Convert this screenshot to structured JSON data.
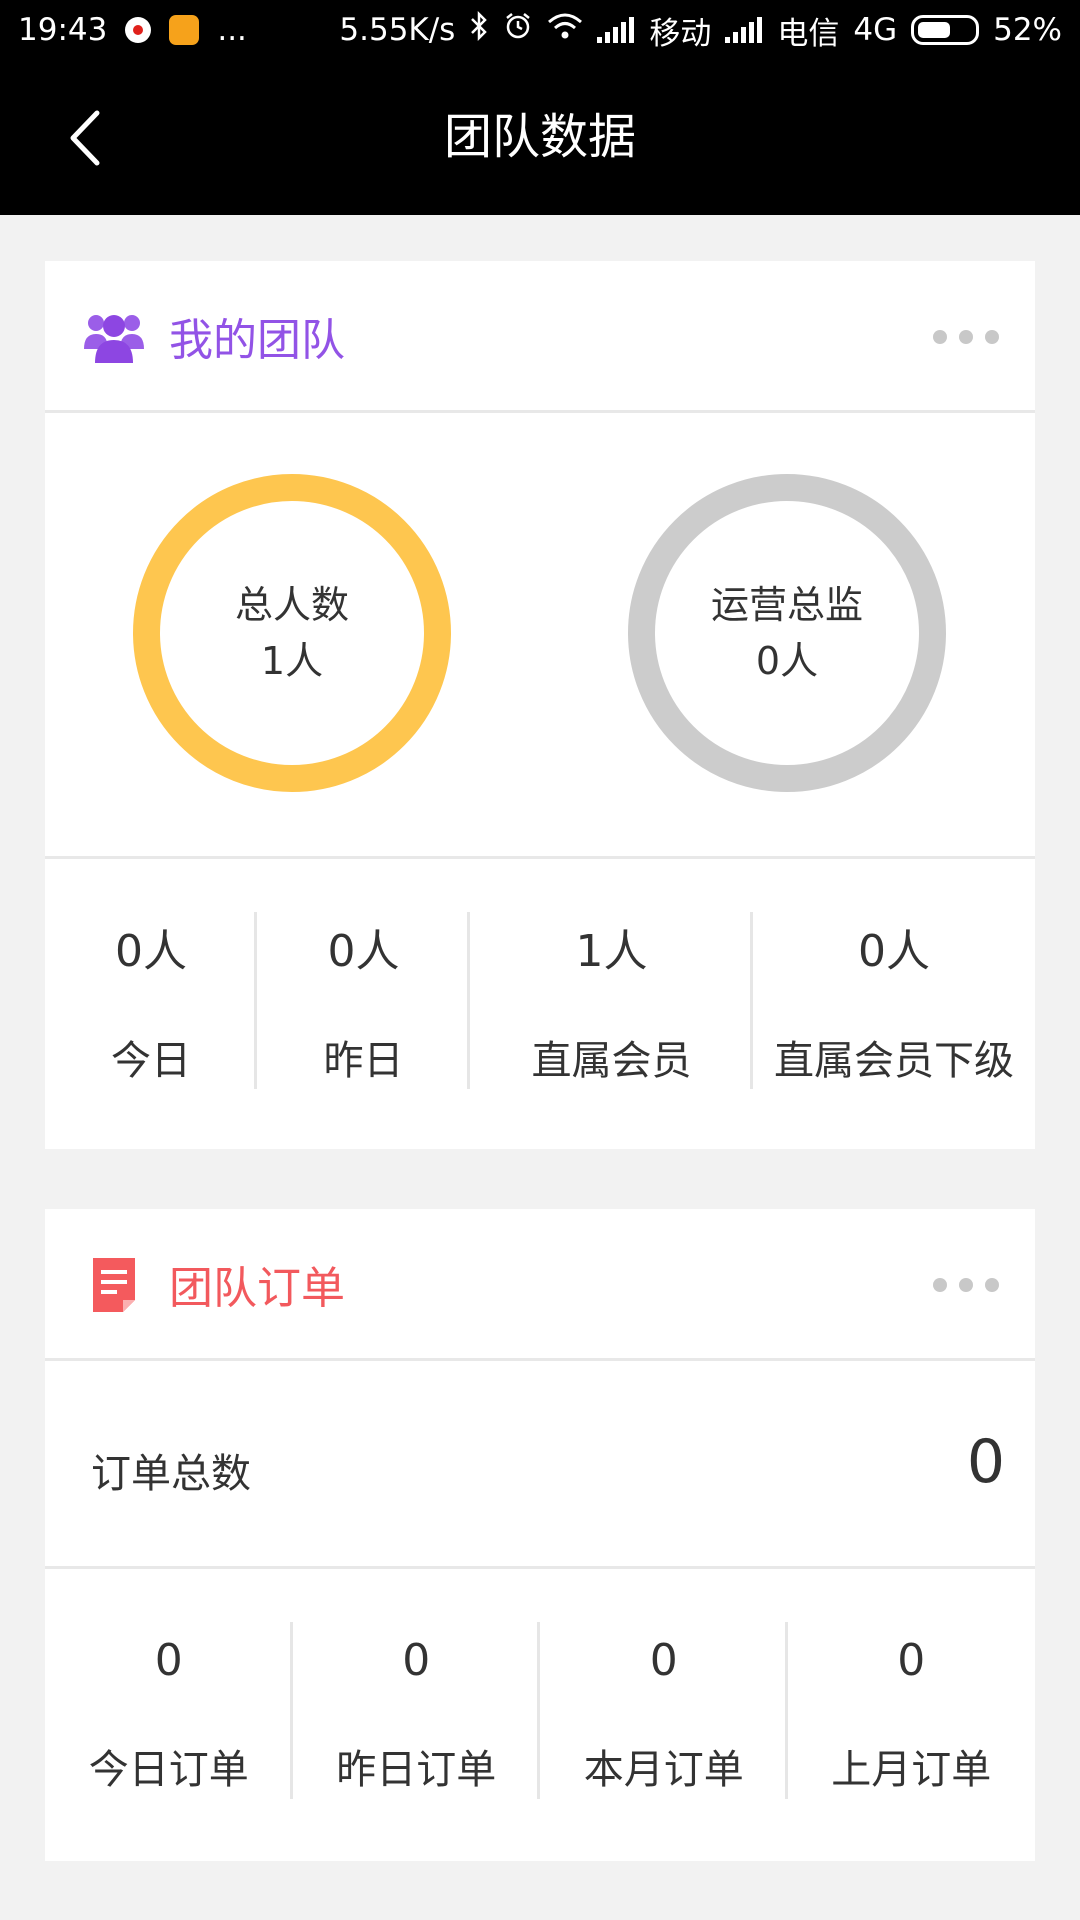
{
  "status_bar": {
    "time": "19:43",
    "more": "...",
    "net_speed": "5.55K/s",
    "carrier1": "移动",
    "carrier2": "电信",
    "network_type": "4G",
    "battery": "52%"
  },
  "navbar": {
    "title": "团队数据"
  },
  "team_card": {
    "title": "我的团队",
    "title_color": "#9253e6",
    "rings": [
      {
        "label": "总人数",
        "value": "1人",
        "color": "#fec64f"
      },
      {
        "label": "运营总监",
        "value": "0人",
        "color": "#cccccc"
      }
    ],
    "stats": [
      {
        "value": "0人",
        "label": "今日"
      },
      {
        "value": "0人",
        "label": "昨日"
      },
      {
        "value": "1人",
        "label": "直属会员"
      },
      {
        "value": "0人",
        "label": "直属会员下级"
      }
    ]
  },
  "orders_card": {
    "title": "团队订单",
    "title_color": "#f2595d",
    "total_label": "订单总数",
    "total_value": "0",
    "stats": [
      {
        "value": "0",
        "label": "今日订单"
      },
      {
        "value": "0",
        "label": "昨日订单"
      },
      {
        "value": "0",
        "label": "本月订单"
      },
      {
        "value": "0",
        "label": "上月订单"
      }
    ]
  },
  "icons": [
    "back-arrow-icon",
    "team-users-icon",
    "order-document-icon",
    "more-dots-icon"
  ]
}
